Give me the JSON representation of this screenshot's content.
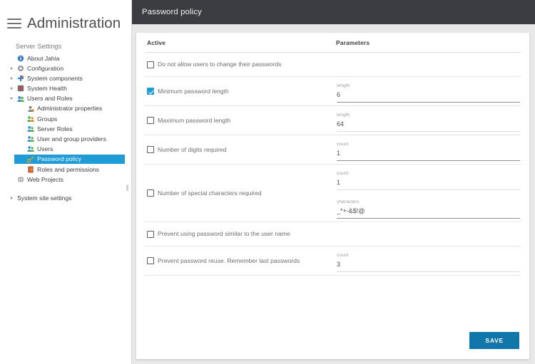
{
  "sidebar": {
    "brand_title": "Administration",
    "menu_icon": "hamburger-icon",
    "section_label": "Server Settings",
    "items": [
      {
        "label": "About Jahia",
        "icon": "info-icon",
        "depth": 0,
        "arrow": "none",
        "selected": false
      },
      {
        "label": "Configuration",
        "icon": "gear-icon",
        "depth": 0,
        "arrow": "collapsed",
        "selected": false
      },
      {
        "label": "System components",
        "icon": "puzzle-icon",
        "depth": 0,
        "arrow": "collapsed",
        "selected": false
      },
      {
        "label": "System Health",
        "icon": "health-icon",
        "depth": 0,
        "arrow": "collapsed",
        "selected": false
      },
      {
        "label": "Users and Roles",
        "icon": "users-icon",
        "depth": 0,
        "arrow": "expanded",
        "selected": false
      },
      {
        "label": "Administrator properties",
        "icon": "user-admin-icon",
        "depth": 1,
        "arrow": "none",
        "selected": false
      },
      {
        "label": "Groups",
        "icon": "group-icon",
        "depth": 1,
        "arrow": "none",
        "selected": false
      },
      {
        "label": "Server Roles",
        "icon": "role-icon",
        "depth": 1,
        "arrow": "none",
        "selected": false
      },
      {
        "label": "User and group providers",
        "icon": "provider-icon",
        "depth": 1,
        "arrow": "none",
        "selected": false
      },
      {
        "label": "Users",
        "icon": "users-small-icon",
        "depth": 1,
        "arrow": "none",
        "selected": false
      },
      {
        "label": "Password policy",
        "icon": "key-icon",
        "depth": 1,
        "arrow": "none",
        "selected": true
      },
      {
        "label": "Roles and permissions",
        "icon": "permissions-icon",
        "depth": 1,
        "arrow": "none",
        "selected": false
      },
      {
        "label": "Web Projects",
        "icon": "globe-icon",
        "depth": 0,
        "arrow": "none",
        "selected": false
      }
    ],
    "bottom_item": {
      "label": "System site settings",
      "arrow": "collapsed"
    },
    "collapse_handle": "sidebar-collapse-handle"
  },
  "topbar": {
    "title": "Password policy"
  },
  "table": {
    "headers": {
      "active": "Active",
      "parameters": "Parameters"
    },
    "rows": [
      {
        "label": "Do not allow users to change their passwords",
        "checked": false,
        "fields": []
      },
      {
        "label": "Minimum password length",
        "checked": true,
        "fields": [
          {
            "label": "length",
            "value": "6",
            "strong": true
          }
        ]
      },
      {
        "label": "Maximum password length",
        "checked": false,
        "fields": [
          {
            "label": "length",
            "value": "64",
            "strong": false
          }
        ]
      },
      {
        "label": "Number of digits required",
        "checked": false,
        "fields": [
          {
            "label": "count",
            "value": "1",
            "strong": true
          }
        ]
      },
      {
        "label": "Number of special characters required",
        "checked": false,
        "fields": [
          {
            "label": "count",
            "value": "1",
            "strong": false
          },
          {
            "label": "characters",
            "value": "_*+-&$!@",
            "strong": true
          }
        ]
      },
      {
        "label": "Prevent using password similar to the user name",
        "checked": false,
        "fields": []
      },
      {
        "label": "Prevent password reuse. Remember last passwords",
        "checked": false,
        "fields": [
          {
            "label": "count",
            "value": "3",
            "strong": false
          }
        ]
      }
    ]
  },
  "footer": {
    "save_label": "SAVE"
  },
  "colors": {
    "accent_blue": "#1f9cd5",
    "save_blue": "#1177aa",
    "topbar_dark": "#3b3d42",
    "content_bg": "#e8e8e8"
  }
}
